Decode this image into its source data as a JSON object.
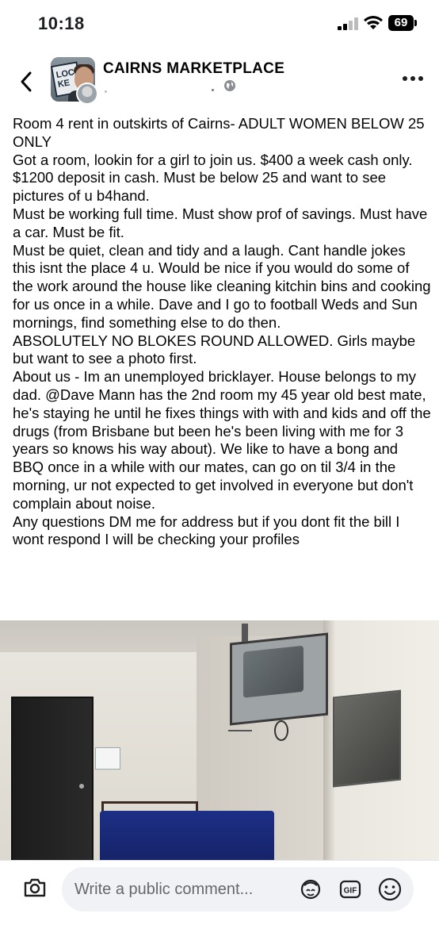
{
  "status_bar": {
    "time": "10:18",
    "battery": "69"
  },
  "header": {
    "group_name": "CAIRNS MARKETPLACE",
    "group_avatar_text": "LOCAL KE"
  },
  "post": {
    "paragraphs": [
      "Room 4 rent in outskirts of Cairns- ADULT WOMEN BELOW 25 ONLY",
      "Got a room, lookin for a girl to join us. $400 a week cash only. $1200 deposit in cash. Must be below 25 and want to see pictures of u b4hand.",
      "Must be working full time. Must show prof of savings. Must have a car. Must be fit.",
      "Must be quiet, clean and tidy and a laugh. Cant handle jokes this isnt the place 4 u. Would be nice if you would do some of the work around the house like cleaning kitchin bins and cooking for us once in a while. Dave and I go to football Weds and Sun mornings, find something else to do then.",
      "ABSOLUTELY NO BLOKES ROUND ALLOWED. Girls maybe but want to see a photo first.",
      "About us - Im an unemployed bricklayer. House belongs to my dad. @Dave Mann has the 2nd room my 45 year old best mate, he's staying he until he fixes things with with and kids and off the drugs (from Brisbane but been he's been living with me for 3 years so knows his way about). We like to have a bong and BBQ once in a while with our mates, can go on til 3/4 in the morning, ur not expected to get involved in everyone but don't complain about noise.",
      "Any questions DM me for address but if you dont fit the bill I wont respond I will be checking your profiles"
    ]
  },
  "comment_bar": {
    "placeholder": "Write a public comment...",
    "gif_label": "GIF"
  },
  "icons": {
    "back": "chevron-left-icon",
    "more": "more-horizontal-icon",
    "privacy": "globe-icon",
    "camera": "camera-icon",
    "avatar_sticker": "avatar-sticker-icon",
    "gif": "gif-icon",
    "emoji": "emoji-icon"
  },
  "colors": {
    "text": "#050505",
    "muted": "#65676b",
    "input_bg": "#f0f2f5"
  }
}
